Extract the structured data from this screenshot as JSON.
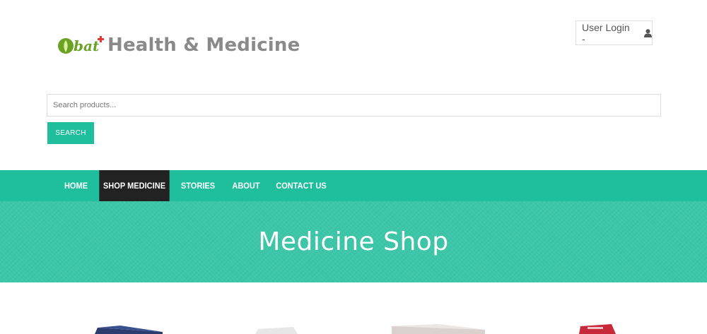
{
  "header": {
    "site_title": "Health & Medicine",
    "logo_text": "bat",
    "user_login": "User Login -",
    "user_icon": "user-icon"
  },
  "search": {
    "placeholder": "Search products...",
    "button": "SEARCH"
  },
  "nav": {
    "items": [
      "HOME",
      "SHOP MEDICINE",
      "STORIES",
      "ABOUT",
      "CONTACT US"
    ],
    "active": "SHOP MEDICINE"
  },
  "banner": {
    "title": "Medicine Shop"
  },
  "colors": {
    "accent": "#1fbf9e",
    "banner": "#3cc6a8",
    "active_nav": "#222222",
    "title_grey": "#8a8a8a"
  }
}
